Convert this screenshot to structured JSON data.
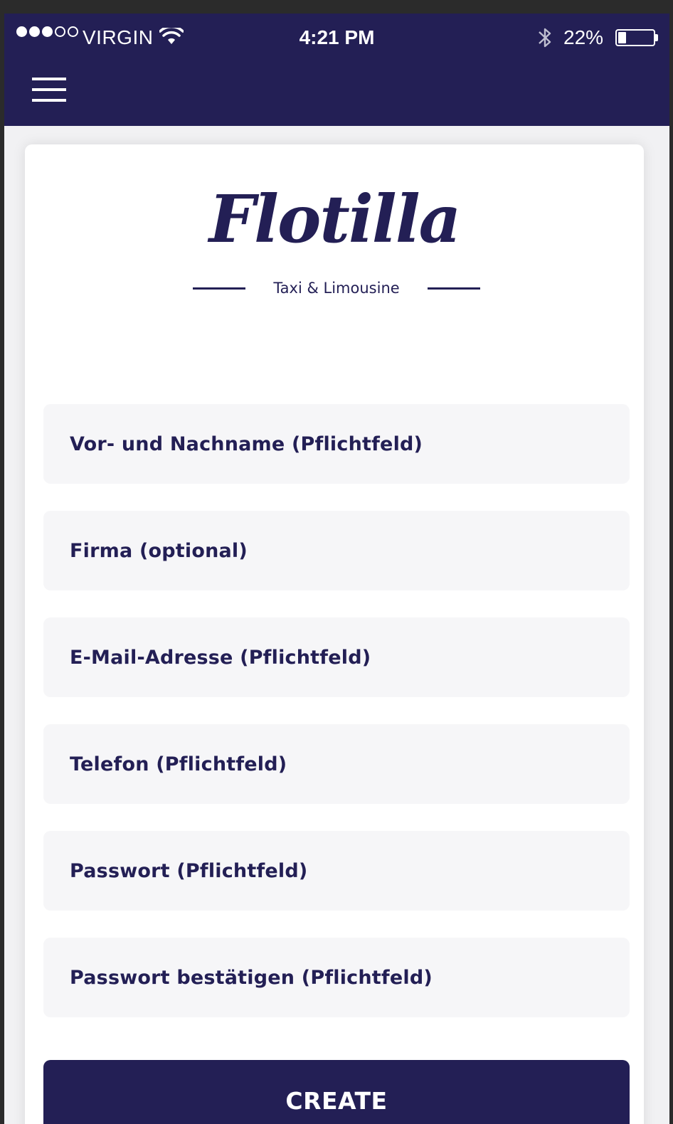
{
  "status_bar": {
    "signal_bars_filled": 3,
    "signal_bars_total": 5,
    "carrier": "VIRGIN",
    "time": "4:21 PM",
    "battery_percent_label": "22%",
    "battery_level": 0.22,
    "wifi_icon": "wifi-icon",
    "bluetooth_icon": "bluetooth-icon"
  },
  "header": {
    "menu_icon": "hamburger-menu-icon",
    "color": "#231f55"
  },
  "logo": {
    "wordmark": "Flotilla",
    "tagline": "Taxi & Limousine"
  },
  "form": {
    "fields": [
      {
        "placeholder": "Vor- und Nachname (Pflichtfeld)"
      },
      {
        "placeholder": "Firma (optional)"
      },
      {
        "placeholder": "E-Mail-Adresse (Pflichtfeld)"
      },
      {
        "placeholder": "Telefon (Pflichtfeld)"
      },
      {
        "placeholder": "Passwort (Pflichtfeld)"
      },
      {
        "placeholder": "Passwort bestätigen (Pflichtfeld)"
      }
    ],
    "submit_label": "CREATE"
  },
  "colors": {
    "brand": "#231f55",
    "field_bg": "#f6f6f8",
    "page_bg": "#f1f1f3"
  }
}
